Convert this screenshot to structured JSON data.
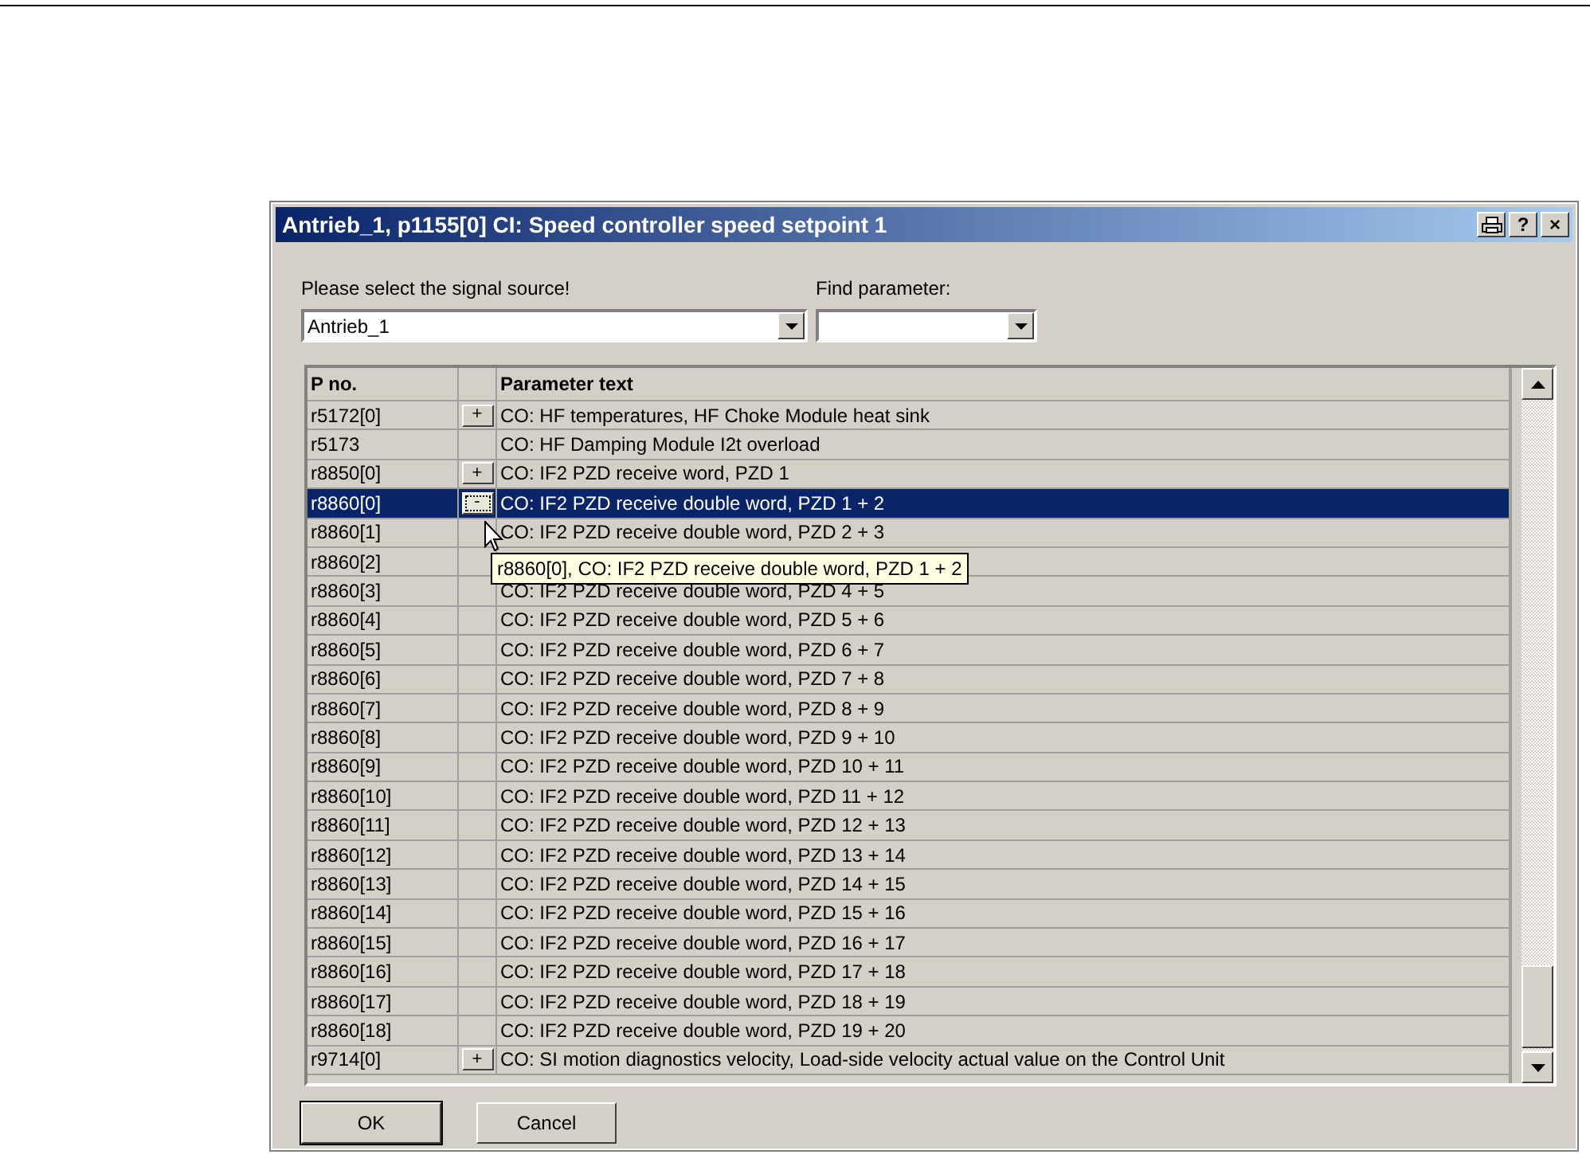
{
  "window": {
    "title": "Antrieb_1, p1155[0] CI: Speed controller speed setpoint 1",
    "title_buttons": [
      "?",
      "×"
    ]
  },
  "source": {
    "label": "Please select the signal source!",
    "value": "Antrieb_1"
  },
  "find": {
    "label": "Find parameter:"
  },
  "table": {
    "columns": [
      "P no.",
      "Parameter text"
    ],
    "rows": [
      {
        "p_no": "r5172[0]",
        "toggle": "+",
        "text": "CO: HF temperatures, HF Choke Module heat sink",
        "selected": false
      },
      {
        "p_no": "r5173",
        "text": "CO: HF Damping Module I2t overload",
        "selected": false
      },
      {
        "p_no": "r8850[0]",
        "toggle": "+",
        "text": "CO: IF2 PZD receive word, PZD 1",
        "selected": false
      },
      {
        "p_no": "r8860[0]",
        "toggle": "-",
        "text": "CO: IF2 PZD receive double word, PZD 1 + 2",
        "selected": true
      },
      {
        "p_no": "r8860[1]",
        "text": "CO: IF2 PZD receive double word, PZD 2 + 3",
        "selected": false
      },
      {
        "p_no": "r8860[2]",
        "selected": false
      },
      {
        "p_no": "r8860[3]",
        "text": "CO: IF2 PZD receive double word, PZD 4 + 5",
        "selected": false
      },
      {
        "p_no": "r8860[4]",
        "text": "CO: IF2 PZD receive double word, PZD 5 + 6",
        "selected": false
      },
      {
        "p_no": "r8860[5]",
        "text": "CO: IF2 PZD receive double word, PZD 6 + 7",
        "selected": false
      },
      {
        "p_no": "r8860[6]",
        "text": "CO: IF2 PZD receive double word, PZD 7 + 8",
        "selected": false
      },
      {
        "p_no": "r8860[7]",
        "text": "CO: IF2 PZD receive double word, PZD 8 + 9",
        "selected": false
      },
      {
        "p_no": "r8860[8]",
        "text": "CO: IF2 PZD receive double word, PZD 9 + 10",
        "selected": false
      },
      {
        "p_no": "r8860[9]",
        "text": "CO: IF2 PZD receive double word, PZD 10 + 11",
        "selected": false
      },
      {
        "p_no": "r8860[10]",
        "text": "CO: IF2 PZD receive double word, PZD 11 + 12",
        "selected": false
      },
      {
        "p_no": "r8860[11]",
        "text": "CO: IF2 PZD receive double word, PZD 12 + 13",
        "selected": false
      },
      {
        "p_no": "r8860[12]",
        "text": "CO: IF2 PZD receive double word, PZD 13 + 14",
        "selected": false
      },
      {
        "p_no": "r8860[13]",
        "text": "CO: IF2 PZD receive double word, PZD 14 + 15",
        "selected": false
      },
      {
        "p_no": "r8860[14]",
        "text": "CO: IF2 PZD receive double word, PZD 15 + 16",
        "selected": false
      },
      {
        "p_no": "r8860[15]",
        "text": "CO: IF2 PZD receive double word, PZD 16 + 17",
        "selected": false
      },
      {
        "p_no": "r8860[16]",
        "text": "CO: IF2 PZD receive double word, PZD 17 + 18",
        "selected": false
      },
      {
        "p_no": "r8860[17]",
        "text": "CO: IF2 PZD receive double word, PZD 18 + 19",
        "selected": false
      },
      {
        "p_no": "r8860[18]",
        "text": "CO: IF2 PZD receive double word, PZD 19 + 20",
        "selected": false
      },
      {
        "p_no": "r9714[0]",
        "toggle": "+",
        "text": "CO: SI motion diagnostics velocity, Load-side velocity actual value on the Control Unit",
        "selected": false
      }
    ]
  },
  "tooltip": "r8860[0],  CO: IF2 PZD receive double word, PZD 1 + 2",
  "buttons": [
    {
      "label": "OK",
      "default": true
    },
    {
      "label": "Cancel",
      "default": false
    }
  ]
}
